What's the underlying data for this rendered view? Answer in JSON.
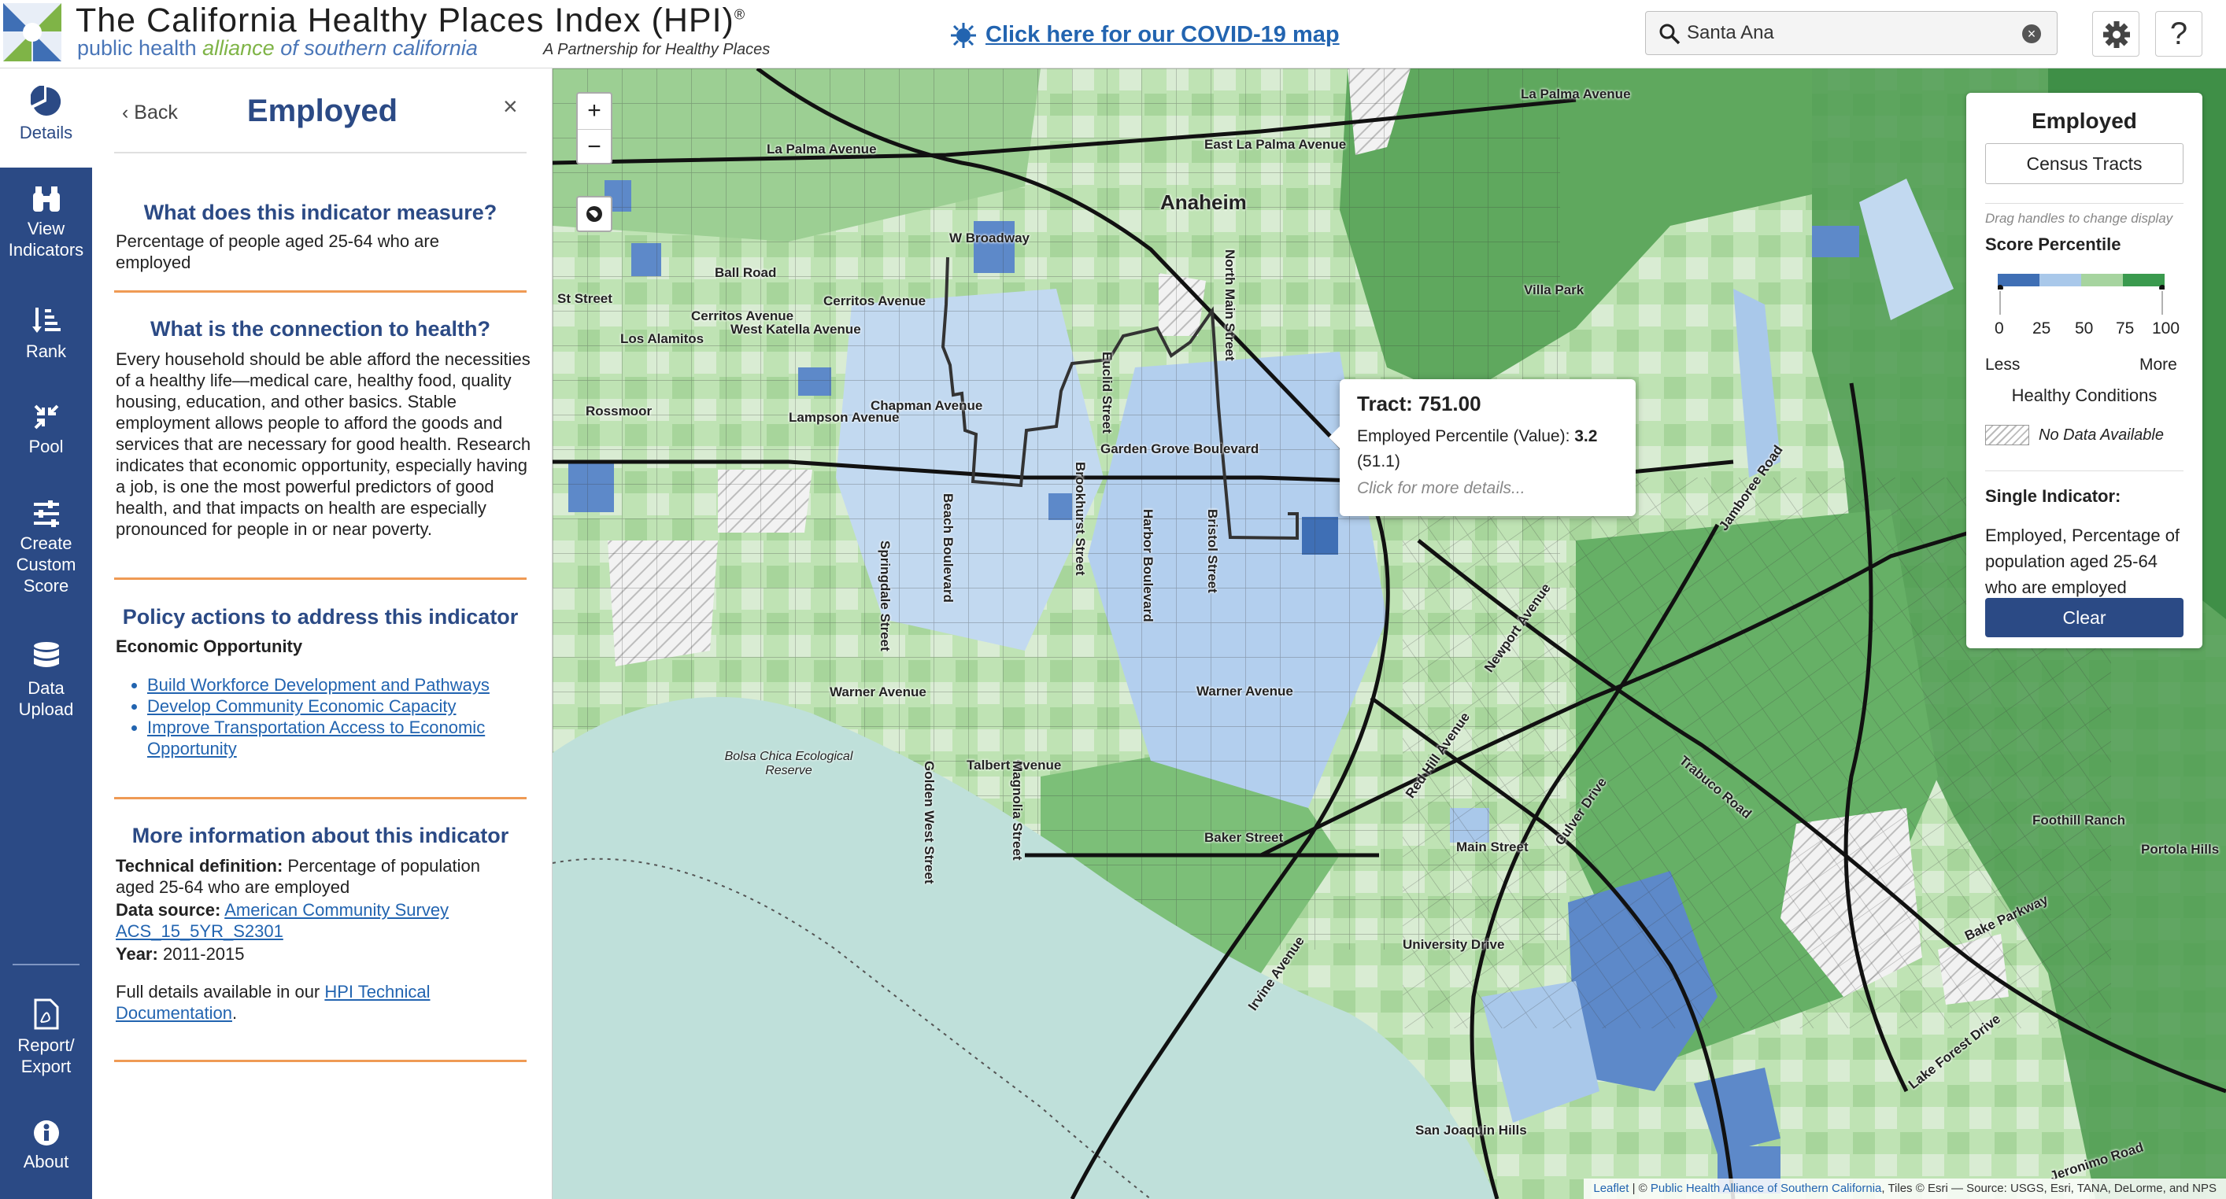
{
  "header": {
    "title": "The California Healthy Places Index (HPI)",
    "title_mark": "®",
    "subtitle_part1": "public health ",
    "subtitle_part2": "alliance",
    "subtitle_part3": " of southern california",
    "tagline": "A Partnership for Healthy Places",
    "covid_link": "Click here for our COVID-19 map",
    "search_value": "Santa Ana",
    "settings_icon": "gear-icon",
    "help_label": "?"
  },
  "nav": {
    "items": [
      {
        "label": "Details",
        "icon": "pie-chart-icon"
      },
      {
        "label": "View Indicators",
        "icon": "binoculars-icon"
      },
      {
        "label": "Rank",
        "icon": "rank-icon"
      },
      {
        "label": "Pool",
        "icon": "pool-icon"
      },
      {
        "label": "Create Custom Score",
        "icon": "sliders-icon"
      },
      {
        "label": "Data Upload",
        "icon": "database-icon"
      },
      {
        "label": "Report/ Export",
        "icon": "pdf-icon"
      },
      {
        "label": "About",
        "icon": "info-icon"
      }
    ],
    "active_color": "#2b4a85"
  },
  "panel": {
    "back_label": "Back",
    "title": "Employed",
    "close_label": "×",
    "s1_heading": "What does this indicator measure?",
    "s1_text": "Percentage of people aged 25-64 who are employed",
    "s2_heading": "What is the connection to health?",
    "s2_text": "Every household should be able afford the necessities of a healthy life—medical care, healthy food, quality housing, education, and other basics. Stable employment allows people to afford the goods and services that are necessary for good health. Research indicates that economic opportunity, especially having a job, is one the most powerful predictors of good health, and that impacts on health are especially pronounced for people in or near poverty.",
    "s3_heading": "Policy actions to address this indicator",
    "s3_sub": "Economic Opportunity",
    "s3_links": [
      "Build Workforce Development and Pathways",
      "Develop Community Economic Capacity",
      "Improve Transportation Access to Economic Opportunity"
    ],
    "s4_heading": "More information about this indicator",
    "tech_def_label": "Technical definition:",
    "tech_def_text": " Percentage of population aged 25-64 who are employed",
    "source_label": "Data source:",
    "source_link": "American Community Survey ACS_15_5YR_S2301",
    "year_label": "Year:",
    "year_value": " 2011-2015",
    "full_details_text": "Full details available in our ",
    "full_details_link": "HPI Technical Documentation",
    "full_details_end": "."
  },
  "map": {
    "zoom_in": "+",
    "zoom_out": "−",
    "labels": {
      "anaheim": "Anaheim",
      "la_palma_1": "La Palma Avenue",
      "la_palma_2": "La Palma Avenue",
      "east_la_palma": "East La Palma Avenue",
      "w_broadway": "W Broadway",
      "ball_road": "Ball Road",
      "cerritos_1": "Cerritos Avenue",
      "cerritos_2": "Cerritos Avenue",
      "west_katella": "West Katella Avenue",
      "los_alamitos": "Los Alamitos",
      "rossmoor": "Rossmoor",
      "chapman": "Chapman Avenue",
      "lampson": "Lampson Avenue",
      "garden_grove": "Garden Grove Boulevard",
      "villa_park": "Villa Park",
      "warner_1": "Warner Avenue",
      "warner_2": "Warner Avenue",
      "talbert": "Talbert Avenue",
      "baker": "Baker Street",
      "bolsa_chica": "Bolsa Chica Ecological Reserve",
      "main_street": "Main Street",
      "university": "University Drive",
      "foothill_ranch": "Foothill Ranch",
      "portola_hills": "Portola Hills",
      "bake_parkway": "Bake Parkway",
      "lake_forest": "Lake Forest Drive",
      "san_joaquin": "San Joaquin Hills",
      "jeronimo": "Jeronimo Road",
      "st_street": "St Street",
      "euclid_1": "Euclid Street",
      "beach_blvd": "Beach Boulevard",
      "harbor_blvd": "Harbor Boulevard",
      "brookhurst": "Brookhurst Street",
      "springdale": "Springdale Street",
      "bristol": "Bristol Street",
      "north_main": "North Main Street",
      "jamboree": "Jamboree Road",
      "newport": "Newport Avenue",
      "irvine_ave": "Irvine Avenue",
      "red_hill": "Red Hill Avenue",
      "trabuco": "Trabuco Road",
      "culver": "Culver Drive",
      "golden_west": "Golden West Street",
      "magnolia": "Magnolia Street"
    },
    "popup": {
      "title": "Tract: 751.00",
      "value_label": "Employed Percentile (Value): ",
      "value": "3.2",
      "raw": "(51.1)",
      "more": "Click for more details..."
    },
    "attribution_1": "Leaflet",
    "attribution_2": " | © ",
    "attribution_3": "Public Health Alliance of Southern California",
    "attribution_4": ", Tiles © Esri — Source: USGS, Esri, TANA, DeLorme, and NPS"
  },
  "legend": {
    "title": "Employed",
    "geography": "Census Tracts",
    "drag_hint": "Drag handles to change display",
    "score_label": "Score Percentile",
    "ticks": [
      "0",
      "25",
      "50",
      "75",
      "100"
    ],
    "less": "Less",
    "more": "More",
    "healthy_conditions": "Healthy Conditions",
    "no_data": "No Data Available",
    "single_label": "Single Indicator:",
    "single_desc": "Employed, Percentage of population aged 25-64 who are employed",
    "clear_label": "Clear",
    "colors": [
      "#3f6fb5",
      "#a9c8ea",
      "#a6d49f",
      "#3a9a4e"
    ]
  }
}
